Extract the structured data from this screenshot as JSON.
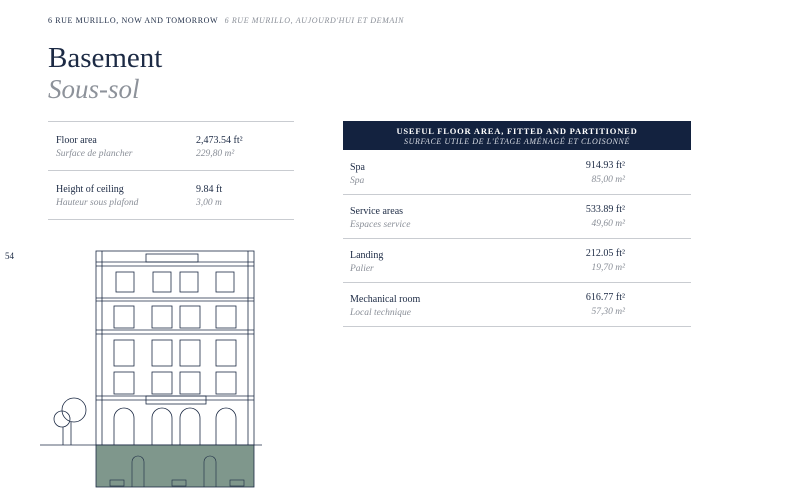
{
  "running_head": {
    "en": "6 RUE MURILLO, NOW AND TOMORROW",
    "fr": "6 RUE MURILLO, AUJOURD'HUI ET DEMAIN"
  },
  "title": {
    "en": "Basement",
    "fr": "Sous-sol"
  },
  "specs": [
    {
      "label_en": "Floor area",
      "label_fr": "Surface de plancher",
      "value_en": "2,473.54 ft²",
      "value_fr": "229,80 m²"
    },
    {
      "label_en": "Height of ceiling",
      "label_fr": "Hauteur sous plafond",
      "value_en": "9.84 ft",
      "value_fr": "3,00 m"
    }
  ],
  "page_number": "54",
  "area_table": {
    "header_en": "USEFUL FLOOR AREA, FITTED AND PARTITIONED",
    "header_fr": "SURFACE UTILE DE L'ÉTAGE AMÉNAGÉ ET CLOISONNÉ",
    "rows": [
      {
        "label_en": "Spa",
        "label_fr": "Spa",
        "value_en": "914.93 ft²",
        "value_fr": "85,00 m²"
      },
      {
        "label_en": "Service areas",
        "label_fr": "Espaces service",
        "value_en": "533.89 ft²",
        "value_fr": "49,60 m²"
      },
      {
        "label_en": "Landing",
        "label_fr": "Palier",
        "value_en": "212.05 ft²",
        "value_fr": "19,70 m²"
      },
      {
        "label_en": "Mechanical room",
        "label_fr": "Local technique",
        "value_en": "616.77 ft²",
        "value_fr": "57,30 m²"
      }
    ]
  },
  "colors": {
    "navy": "#13223f",
    "text": "#1c2a44",
    "muted": "#8a8f98",
    "basement_fill": "#7f978c"
  },
  "illustration": "building-facade-elevation"
}
